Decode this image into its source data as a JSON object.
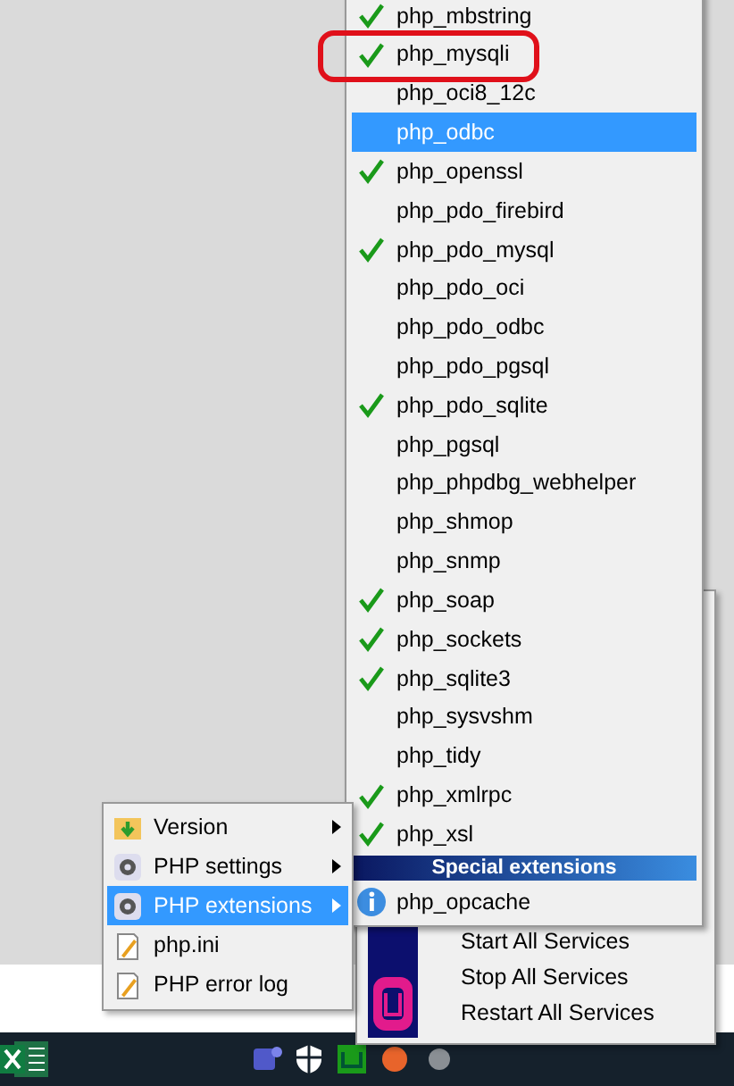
{
  "extensions_menu": {
    "items": [
      {
        "label": "php_mbstring",
        "checked": true,
        "selected": false,
        "circled": false
      },
      {
        "label": "php_mysqli",
        "checked": true,
        "selected": false,
        "circled": true
      },
      {
        "label": "php_oci8_12c",
        "checked": false,
        "selected": false,
        "circled": false
      },
      {
        "label": "php_odbc",
        "checked": false,
        "selected": true,
        "circled": false
      },
      {
        "label": "php_openssl",
        "checked": true,
        "selected": false,
        "circled": false
      },
      {
        "label": "php_pdo_firebird",
        "checked": false,
        "selected": false,
        "circled": false
      },
      {
        "label": "php_pdo_mysql",
        "checked": true,
        "selected": false,
        "circled": false
      },
      {
        "label": "php_pdo_oci",
        "checked": false,
        "selected": false,
        "circled": false
      },
      {
        "label": "php_pdo_odbc",
        "checked": false,
        "selected": false,
        "circled": false
      },
      {
        "label": "php_pdo_pgsql",
        "checked": false,
        "selected": false,
        "circled": false
      },
      {
        "label": "php_pdo_sqlite",
        "checked": true,
        "selected": false,
        "circled": false
      },
      {
        "label": "php_pgsql",
        "checked": false,
        "selected": false,
        "circled": false
      },
      {
        "label": "php_phpdbg_webhelper",
        "checked": false,
        "selected": false,
        "circled": false
      },
      {
        "label": "php_shmop",
        "checked": false,
        "selected": false,
        "circled": false
      },
      {
        "label": "php_snmp",
        "checked": false,
        "selected": false,
        "circled": false
      },
      {
        "label": "php_soap",
        "checked": true,
        "selected": false,
        "circled": false
      },
      {
        "label": "php_sockets",
        "checked": true,
        "selected": false,
        "circled": false
      },
      {
        "label": "php_sqlite3",
        "checked": true,
        "selected": false,
        "circled": false
      },
      {
        "label": "php_sysvshm",
        "checked": false,
        "selected": false,
        "circled": false
      },
      {
        "label": "php_tidy",
        "checked": false,
        "selected": false,
        "circled": false
      },
      {
        "label": "php_xmlrpc",
        "checked": true,
        "selected": false,
        "circled": false
      },
      {
        "label": "php_xsl",
        "checked": true,
        "selected": false,
        "circled": false
      }
    ],
    "section_header": "Special extensions",
    "special_items": [
      {
        "label": "php_opcache"
      }
    ]
  },
  "php_menu": {
    "items": [
      {
        "label": "Version",
        "kind": "folder",
        "has_submenu": true,
        "selected": false
      },
      {
        "label": "PHP settings",
        "kind": "gear",
        "has_submenu": true,
        "selected": false
      },
      {
        "label": "PHP extensions",
        "kind": "gear",
        "has_submenu": true,
        "selected": true
      },
      {
        "label": "php.ini",
        "kind": "document",
        "has_submenu": false,
        "selected": false
      },
      {
        "label": "PHP error log",
        "kind": "document",
        "has_submenu": false,
        "selected": false
      }
    ]
  },
  "wamp_menu": {
    "items": [
      "Start All Services",
      "Stop All Services",
      "Restart All Services"
    ]
  }
}
